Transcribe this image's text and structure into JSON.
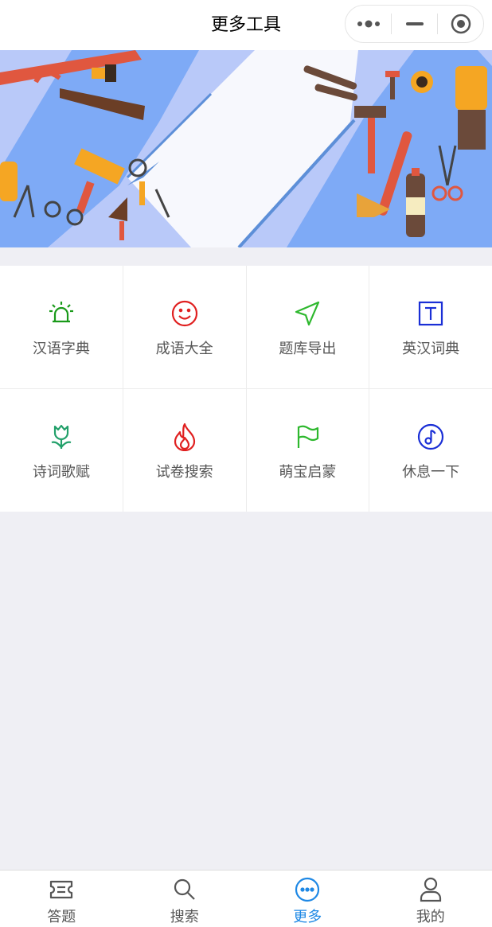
{
  "navbar": {
    "title": "更多工具"
  },
  "grid": {
    "items": [
      {
        "label": "汉语字典",
        "icon": "alarm-light-icon",
        "color": "#1a9a1a"
      },
      {
        "label": "成语大全",
        "icon": "smile-icon",
        "color": "#e02020"
      },
      {
        "label": "题库导出",
        "icon": "navigation-arrow-icon",
        "color": "#2eb82e"
      },
      {
        "label": "英汉词典",
        "icon": "text-box-icon",
        "color": "#1a2fd6"
      },
      {
        "label": "诗词歌赋",
        "icon": "tulip-icon",
        "color": "#22a06a"
      },
      {
        "label": "试卷搜索",
        "icon": "fire-icon",
        "color": "#e02020"
      },
      {
        "label": "萌宝启蒙",
        "icon": "flag-icon",
        "color": "#2eb82e"
      },
      {
        "label": "休息一下",
        "icon": "music-note-icon",
        "color": "#1a2fd6"
      }
    ]
  },
  "tabbar": {
    "items": [
      {
        "label": "答题",
        "icon": "ticket-icon",
        "active": false
      },
      {
        "label": "搜索",
        "icon": "search-icon",
        "active": false
      },
      {
        "label": "更多",
        "icon": "more-circle-icon",
        "active": true
      },
      {
        "label": "我的",
        "icon": "user-icon",
        "active": false
      }
    ],
    "active_color": "#1e88e5",
    "inactive_color": "#555555"
  }
}
